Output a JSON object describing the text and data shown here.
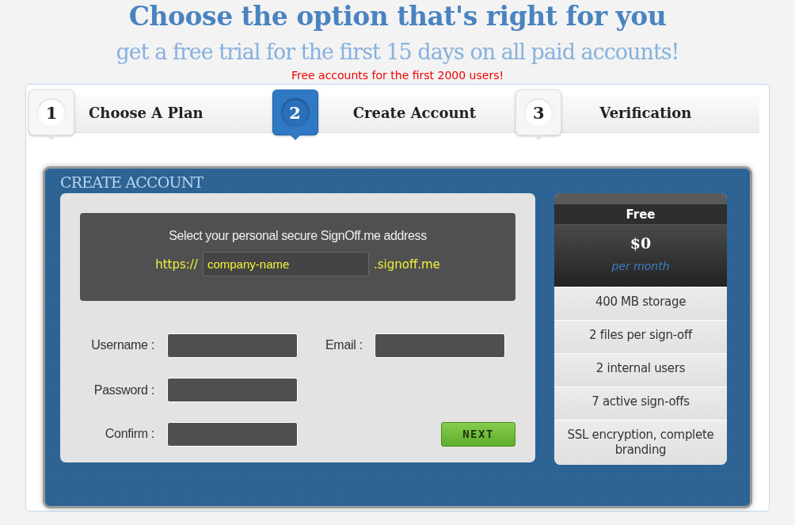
{
  "heading": "Choose the option that's right for you",
  "subheading": "get a free trial for the first 15 days on all paid accounts!",
  "notice": "Free accounts for the first 2000 users!",
  "steps": [
    {
      "number": "1",
      "label": "Choose A Plan",
      "selected": false
    },
    {
      "number": "2",
      "label": "Create Account",
      "selected": true
    },
    {
      "number": "3",
      "label": "Verification",
      "selected": false
    }
  ],
  "panel": {
    "title": "CREATE ACCOUNT",
    "address": {
      "prompt": "Select your personal secure SignOff.me address",
      "prefix": "https://",
      "value": "company-name",
      "suffix": ".signoff.me"
    },
    "form_rows": [
      [
        {
          "label": "Username :"
        },
        {
          "label": "Email :"
        }
      ],
      [
        {
          "label": "Password :"
        }
      ],
      [
        {
          "label": "Confirm :"
        }
      ]
    ],
    "next_button": "NEXT"
  },
  "plan": {
    "name": "Free",
    "price": "$0",
    "period": "per month",
    "features": [
      "400 MB storage",
      "2 files per sign-off",
      "2 internal users",
      "7 active sign-offs",
      "SSL encryption, complete branding"
    ]
  }
}
